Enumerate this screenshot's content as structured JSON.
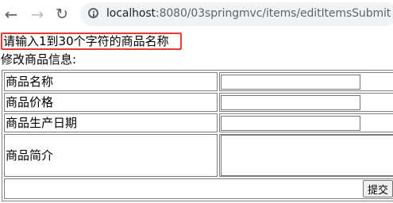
{
  "browser": {
    "url_host": "localhost",
    "url_path": ":8080/03springmvc/items/editItemsSubmit",
    "back_icon": "←",
    "forward_icon": "→",
    "reload_icon": "↻"
  },
  "page": {
    "error_message": "请输入1到30个字符的商品名称",
    "section_title": "修改商品信息:",
    "fields": [
      {
        "label": "商品名称",
        "value": ""
      },
      {
        "label": "商品价格",
        "value": ""
      },
      {
        "label": "商品生产日期",
        "value": ""
      },
      {
        "label": "商品简介",
        "value": ""
      }
    ],
    "submit_label": "提交"
  }
}
